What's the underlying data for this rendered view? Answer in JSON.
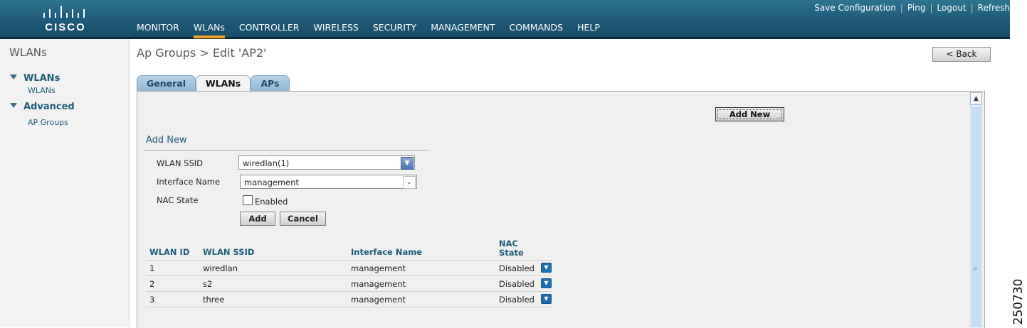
{
  "header": {
    "logo_text": "CISCO",
    "top_links": [
      "Save Configuration",
      "Ping",
      "Logout",
      "Refresh"
    ],
    "menu": [
      "MONITOR",
      "WLANs",
      "CONTROLLER",
      "WIRELESS",
      "SECURITY",
      "MANAGEMENT",
      "COMMANDS",
      "HELP"
    ],
    "active_menu": "WLANs"
  },
  "sidebar": {
    "title": "WLANs",
    "groups": [
      {
        "label": "WLANs",
        "items": [
          "WLANs"
        ]
      },
      {
        "label": "Advanced",
        "items": [
          "AP Groups"
        ]
      }
    ]
  },
  "page": {
    "title": "Ap Groups > Edit  'AP2'",
    "back_label": "< Back",
    "tabs": [
      "General",
      "WLANs",
      "APs"
    ],
    "active_tab": "WLANs"
  },
  "add_new": {
    "button_label": "Add New",
    "section_title": "Add New",
    "ssid_label": "WLAN SSID",
    "ssid_value": "wiredlan(1)",
    "interface_label": "Interface Name",
    "interface_value": "management",
    "nac_label": "NAC State",
    "nac_checkbox_label": "Enabled",
    "nac_checked": false,
    "add_label": "Add",
    "cancel_label": "Cancel"
  },
  "table": {
    "headers": [
      "WLAN ID",
      "WLAN SSID",
      "Interface Name",
      "NAC State"
    ],
    "rows": [
      {
        "id": "1",
        "ssid": "wiredlan",
        "interface": "management",
        "nac": "Disabled"
      },
      {
        "id": "2",
        "ssid": "s2",
        "interface": "management",
        "nac": "Disabled"
      },
      {
        "id": "3",
        "ssid": "three",
        "interface": "management",
        "nac": "Disabled"
      }
    ]
  },
  "figure_id": "250730",
  "colors": {
    "header": "#1e5a78",
    "accent": "#f0a32b",
    "link": "#1d5c7a",
    "tab": "#8db6d6"
  }
}
